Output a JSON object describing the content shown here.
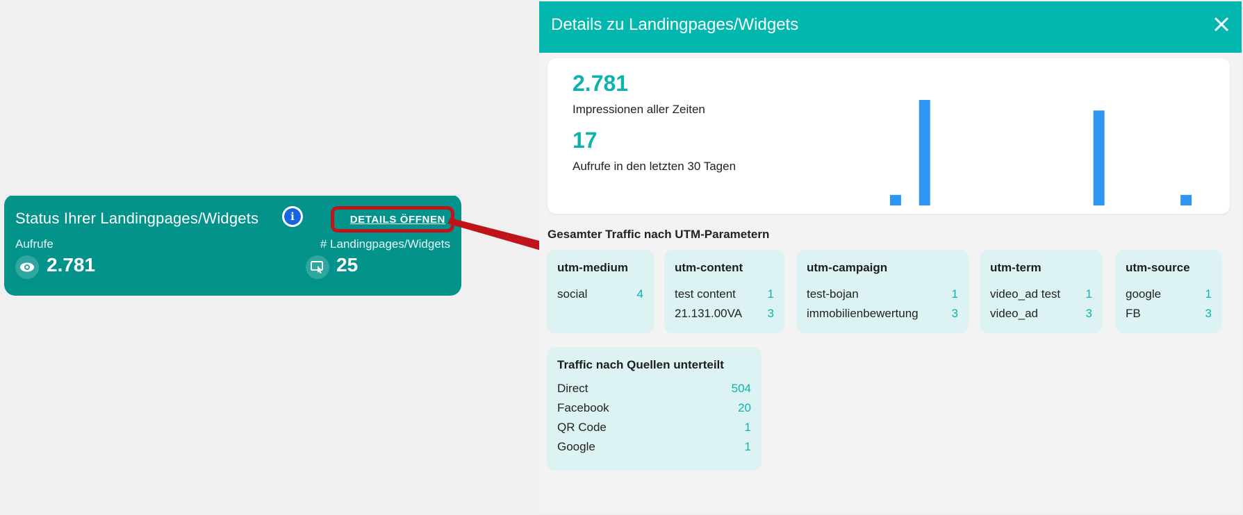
{
  "status_card": {
    "title": "Status Ihrer Landingpages/Widgets",
    "details_label": "DETAILS ÖFFNEN",
    "metrics": [
      {
        "label": "Aufrufe",
        "value": "2.781",
        "icon": "eye-icon"
      },
      {
        "label": "# Landingpages/Widgets",
        "value": "25",
        "icon": "touch-screen-icon"
      }
    ],
    "highlight_color": "#c0141b"
  },
  "panel": {
    "title": "Details zu Landingpages/Widgets",
    "header_color": "#01b7ae",
    "stats": [
      {
        "value": "2.781",
        "caption": "Impressionen aller Zeiten"
      },
      {
        "value": "17",
        "caption": "Aufrufe in den letzten 30 Tagen"
      }
    ],
    "section_title": "Gesamter Traffic nach UTM-Parametern",
    "utm_groups": [
      {
        "name": "utm-medium",
        "rows": [
          {
            "label": "social",
            "count": "4"
          }
        ]
      },
      {
        "name": "utm-content",
        "rows": [
          {
            "label": "test content",
            "count": "1"
          },
          {
            "label": "21.131.00VA",
            "count": "3"
          }
        ]
      },
      {
        "name": "utm-campaign",
        "rows": [
          {
            "label": "test-bojan",
            "count": "1"
          },
          {
            "label": "immobilienbewertung",
            "count": "3"
          }
        ]
      },
      {
        "name": "utm-term",
        "rows": [
          {
            "label": "video_ad test",
            "count": "1"
          },
          {
            "label": "video_ad",
            "count": "3"
          }
        ]
      },
      {
        "name": "utm-source",
        "rows": [
          {
            "label": "google",
            "count": "1"
          },
          {
            "label": "FB",
            "count": "3"
          }
        ]
      }
    ],
    "sources": {
      "title": "Traffic nach Quellen unterteilt",
      "rows": [
        {
          "label": "Direct",
          "count": "504"
        },
        {
          "label": "Facebook",
          "count": "20"
        },
        {
          "label": "QR Code",
          "count": "1"
        },
        {
          "label": "Google",
          "count": "1"
        }
      ]
    }
  },
  "chart_data": {
    "type": "bar",
    "values": [
      1,
      10,
      0,
      0,
      0,
      0,
      0,
      9,
      0,
      0,
      1
    ],
    "bar_color": "#2f97f2",
    "ylim": [
      0,
      10
    ]
  }
}
